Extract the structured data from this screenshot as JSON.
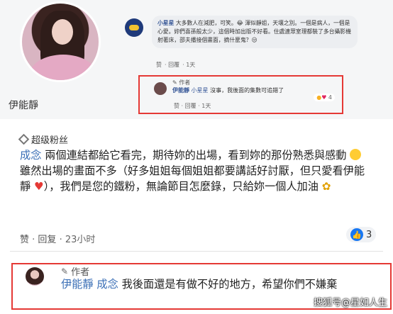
{
  "top": {
    "profile_name": "伊能靜",
    "comment": {
      "author": "小星星",
      "text": "大多數人在減肥，可笑。😂 渾似靜姐，天壤之別。一個是病人，一個是心愛。妳們喜孫般太少，這個時加出版不好看。住處連眾室理都裝了多台攝影機射著床，邵夫播接個畫面，摘什麼鬼？😒",
      "actions": [
        "赞",
        "回覆",
        "1天"
      ]
    },
    "reply": {
      "author_tag": "作者",
      "author": "伊能靜",
      "mention": "小星星",
      "text": "沒事，我後面的集數可追錯了",
      "reaction_count": "4",
      "actions": [
        "赞",
        "回覆",
        "1天"
      ]
    }
  },
  "bottom": {
    "badge": "超级粉丝",
    "comment": {
      "author": "成念",
      "line1": "兩個連結都給它看完，期待妳的出場，看到妳的那份熟悉與感動",
      "line2": "雖然出場的畫面不多（好多姐姐每個姐姐都要講話好討厭，但只愛看伊能靜",
      "line3": "），我們是您的鐵粉，無論節目怎麼錄，只給妳一個人加油"
    },
    "actions": {
      "like": "赞",
      "reply": "回复",
      "time": "23小时"
    },
    "like_count": "3",
    "reply": {
      "author_tag": "作者",
      "author": "伊能靜",
      "mention": "成念",
      "text": "我後面還是有做不好的地方，希望你們不嫌棄"
    }
  },
  "watermark": "搜狐号@星如人生"
}
